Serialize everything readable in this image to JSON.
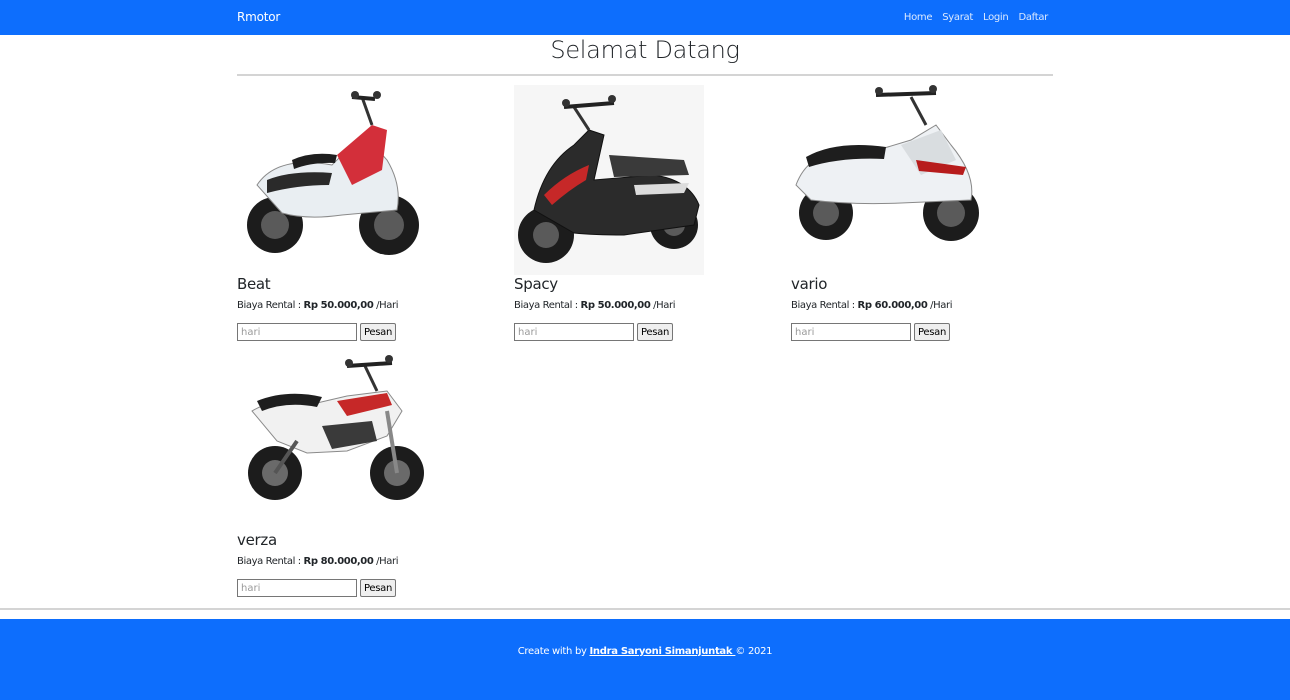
{
  "navbar": {
    "brand": "Rmotor",
    "links": [
      "Home",
      "Syarat",
      "Login",
      "Daftar"
    ]
  },
  "page": {
    "title": "Selamat Datang"
  },
  "products": [
    {
      "name": "Beat",
      "price_label": "Biaya Rental : ",
      "price": "Rp 50.000,00",
      "unit": " /Hari",
      "input_placeholder": "hari",
      "button": "Pesan",
      "color": "#d32f3a"
    },
    {
      "name": "Spacy",
      "price_label": "Biaya Rental : ",
      "price": "Rp 50.000,00",
      "unit": " /Hari",
      "input_placeholder": "hari",
      "button": "Pesan",
      "color": "#c62828"
    },
    {
      "name": "vario",
      "price_label": "Biaya Rental : ",
      "price": "Rp 60.000,00",
      "unit": " /Hari",
      "input_placeholder": "hari",
      "button": "Pesan",
      "color": "#b71c1c"
    },
    {
      "name": "verza",
      "price_label": "Biaya Rental : ",
      "price": "Rp 80.000,00",
      "unit": " /Hari",
      "input_placeholder": "hari",
      "button": "Pesan",
      "color": "#c62828"
    }
  ],
  "footer": {
    "prefix": "Create with by ",
    "author": "Indra Saryoni Simanjuntak ",
    "suffix": "© 2021"
  },
  "colors": {
    "primary": "#0d6efd",
    "text": "#212529"
  }
}
